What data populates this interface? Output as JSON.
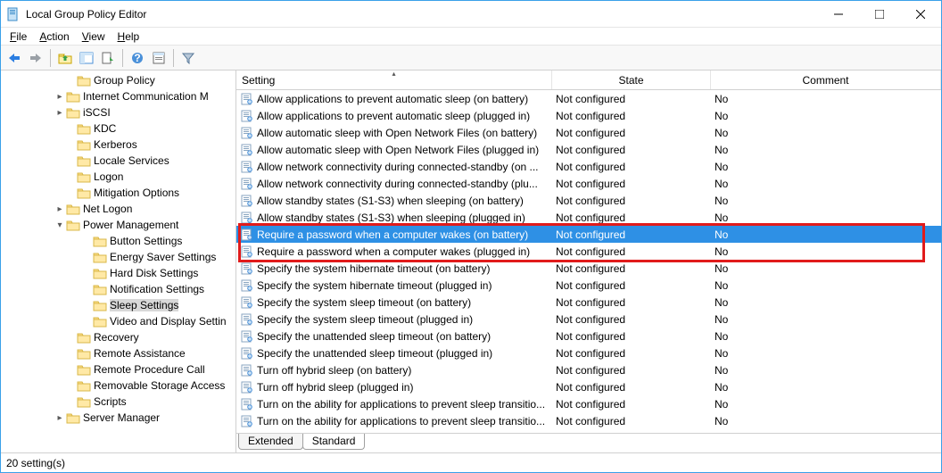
{
  "window": {
    "title": "Local Group Policy Editor"
  },
  "menus": {
    "file": "File",
    "action": "Action",
    "view": "View",
    "help": "Help"
  },
  "tree": {
    "items": [
      {
        "indent": 72,
        "exp": "",
        "label": "Group Policy"
      },
      {
        "indent": 60,
        "exp": "▸",
        "label": "Internet Communication M"
      },
      {
        "indent": 60,
        "exp": "▸",
        "label": "iSCSI"
      },
      {
        "indent": 72,
        "exp": "",
        "label": "KDC"
      },
      {
        "indent": 72,
        "exp": "",
        "label": "Kerberos"
      },
      {
        "indent": 72,
        "exp": "",
        "label": "Locale Services"
      },
      {
        "indent": 72,
        "exp": "",
        "label": "Logon"
      },
      {
        "indent": 72,
        "exp": "",
        "label": "Mitigation Options"
      },
      {
        "indent": 60,
        "exp": "▸",
        "label": "Net Logon"
      },
      {
        "indent": 60,
        "exp": "▾",
        "label": "Power Management"
      },
      {
        "indent": 90,
        "exp": "",
        "label": "Button Settings"
      },
      {
        "indent": 90,
        "exp": "",
        "label": "Energy Saver Settings"
      },
      {
        "indent": 90,
        "exp": "",
        "label": "Hard Disk Settings"
      },
      {
        "indent": 90,
        "exp": "",
        "label": "Notification Settings"
      },
      {
        "indent": 90,
        "exp": "",
        "label": "Sleep Settings",
        "selected": true
      },
      {
        "indent": 90,
        "exp": "",
        "label": "Video and Display Settin"
      },
      {
        "indent": 72,
        "exp": "",
        "label": "Recovery"
      },
      {
        "indent": 72,
        "exp": "",
        "label": "Remote Assistance"
      },
      {
        "indent": 72,
        "exp": "",
        "label": "Remote Procedure Call"
      },
      {
        "indent": 72,
        "exp": "",
        "label": "Removable Storage Access"
      },
      {
        "indent": 72,
        "exp": "",
        "label": "Scripts"
      },
      {
        "indent": 60,
        "exp": "▸",
        "label": "Server Manager"
      }
    ]
  },
  "grid": {
    "headers": {
      "setting": "Setting",
      "state": "State",
      "comment": "Comment"
    },
    "rows": [
      {
        "setting": "Allow applications to prevent automatic sleep (on battery)",
        "state": "Not configured",
        "comment": "No"
      },
      {
        "setting": "Allow applications to prevent automatic sleep (plugged in)",
        "state": "Not configured",
        "comment": "No"
      },
      {
        "setting": "Allow automatic sleep with Open Network Files (on battery)",
        "state": "Not configured",
        "comment": "No"
      },
      {
        "setting": "Allow automatic sleep with Open Network Files (plugged in)",
        "state": "Not configured",
        "comment": "No"
      },
      {
        "setting": "Allow network connectivity during connected-standby (on ...",
        "state": "Not configured",
        "comment": "No"
      },
      {
        "setting": "Allow network connectivity during connected-standby (plu...",
        "state": "Not configured",
        "comment": "No"
      },
      {
        "setting": "Allow standby states (S1-S3) when sleeping (on battery)",
        "state": "Not configured",
        "comment": "No"
      },
      {
        "setting": "Allow standby states (S1-S3) when sleeping (plugged in)",
        "state": "Not configured",
        "comment": "No"
      },
      {
        "setting": "Require a password when a computer wakes (on battery)",
        "state": "Not configured",
        "comment": "No",
        "selected": true
      },
      {
        "setting": "Require a password when a computer wakes (plugged in)",
        "state": "Not configured",
        "comment": "No"
      },
      {
        "setting": "Specify the system hibernate timeout (on battery)",
        "state": "Not configured",
        "comment": "No"
      },
      {
        "setting": "Specify the system hibernate timeout (plugged in)",
        "state": "Not configured",
        "comment": "No"
      },
      {
        "setting": "Specify the system sleep timeout (on battery)",
        "state": "Not configured",
        "comment": "No"
      },
      {
        "setting": "Specify the system sleep timeout (plugged in)",
        "state": "Not configured",
        "comment": "No"
      },
      {
        "setting": "Specify the unattended sleep timeout (on battery)",
        "state": "Not configured",
        "comment": "No"
      },
      {
        "setting": "Specify the unattended sleep timeout (plugged in)",
        "state": "Not configured",
        "comment": "No"
      },
      {
        "setting": "Turn off hybrid sleep (on battery)",
        "state": "Not configured",
        "comment": "No"
      },
      {
        "setting": "Turn off hybrid sleep (plugged in)",
        "state": "Not configured",
        "comment": "No"
      },
      {
        "setting": "Turn on the ability for applications to prevent sleep transitio...",
        "state": "Not configured",
        "comment": "No"
      },
      {
        "setting": "Turn on the ability for applications to prevent sleep transitio...",
        "state": "Not configured",
        "comment": "No"
      }
    ],
    "highlight_rows": {
      "start": 8,
      "count": 2
    }
  },
  "tabs": {
    "extended": "Extended",
    "standard": "Standard"
  },
  "status": {
    "text": "20 setting(s)"
  }
}
